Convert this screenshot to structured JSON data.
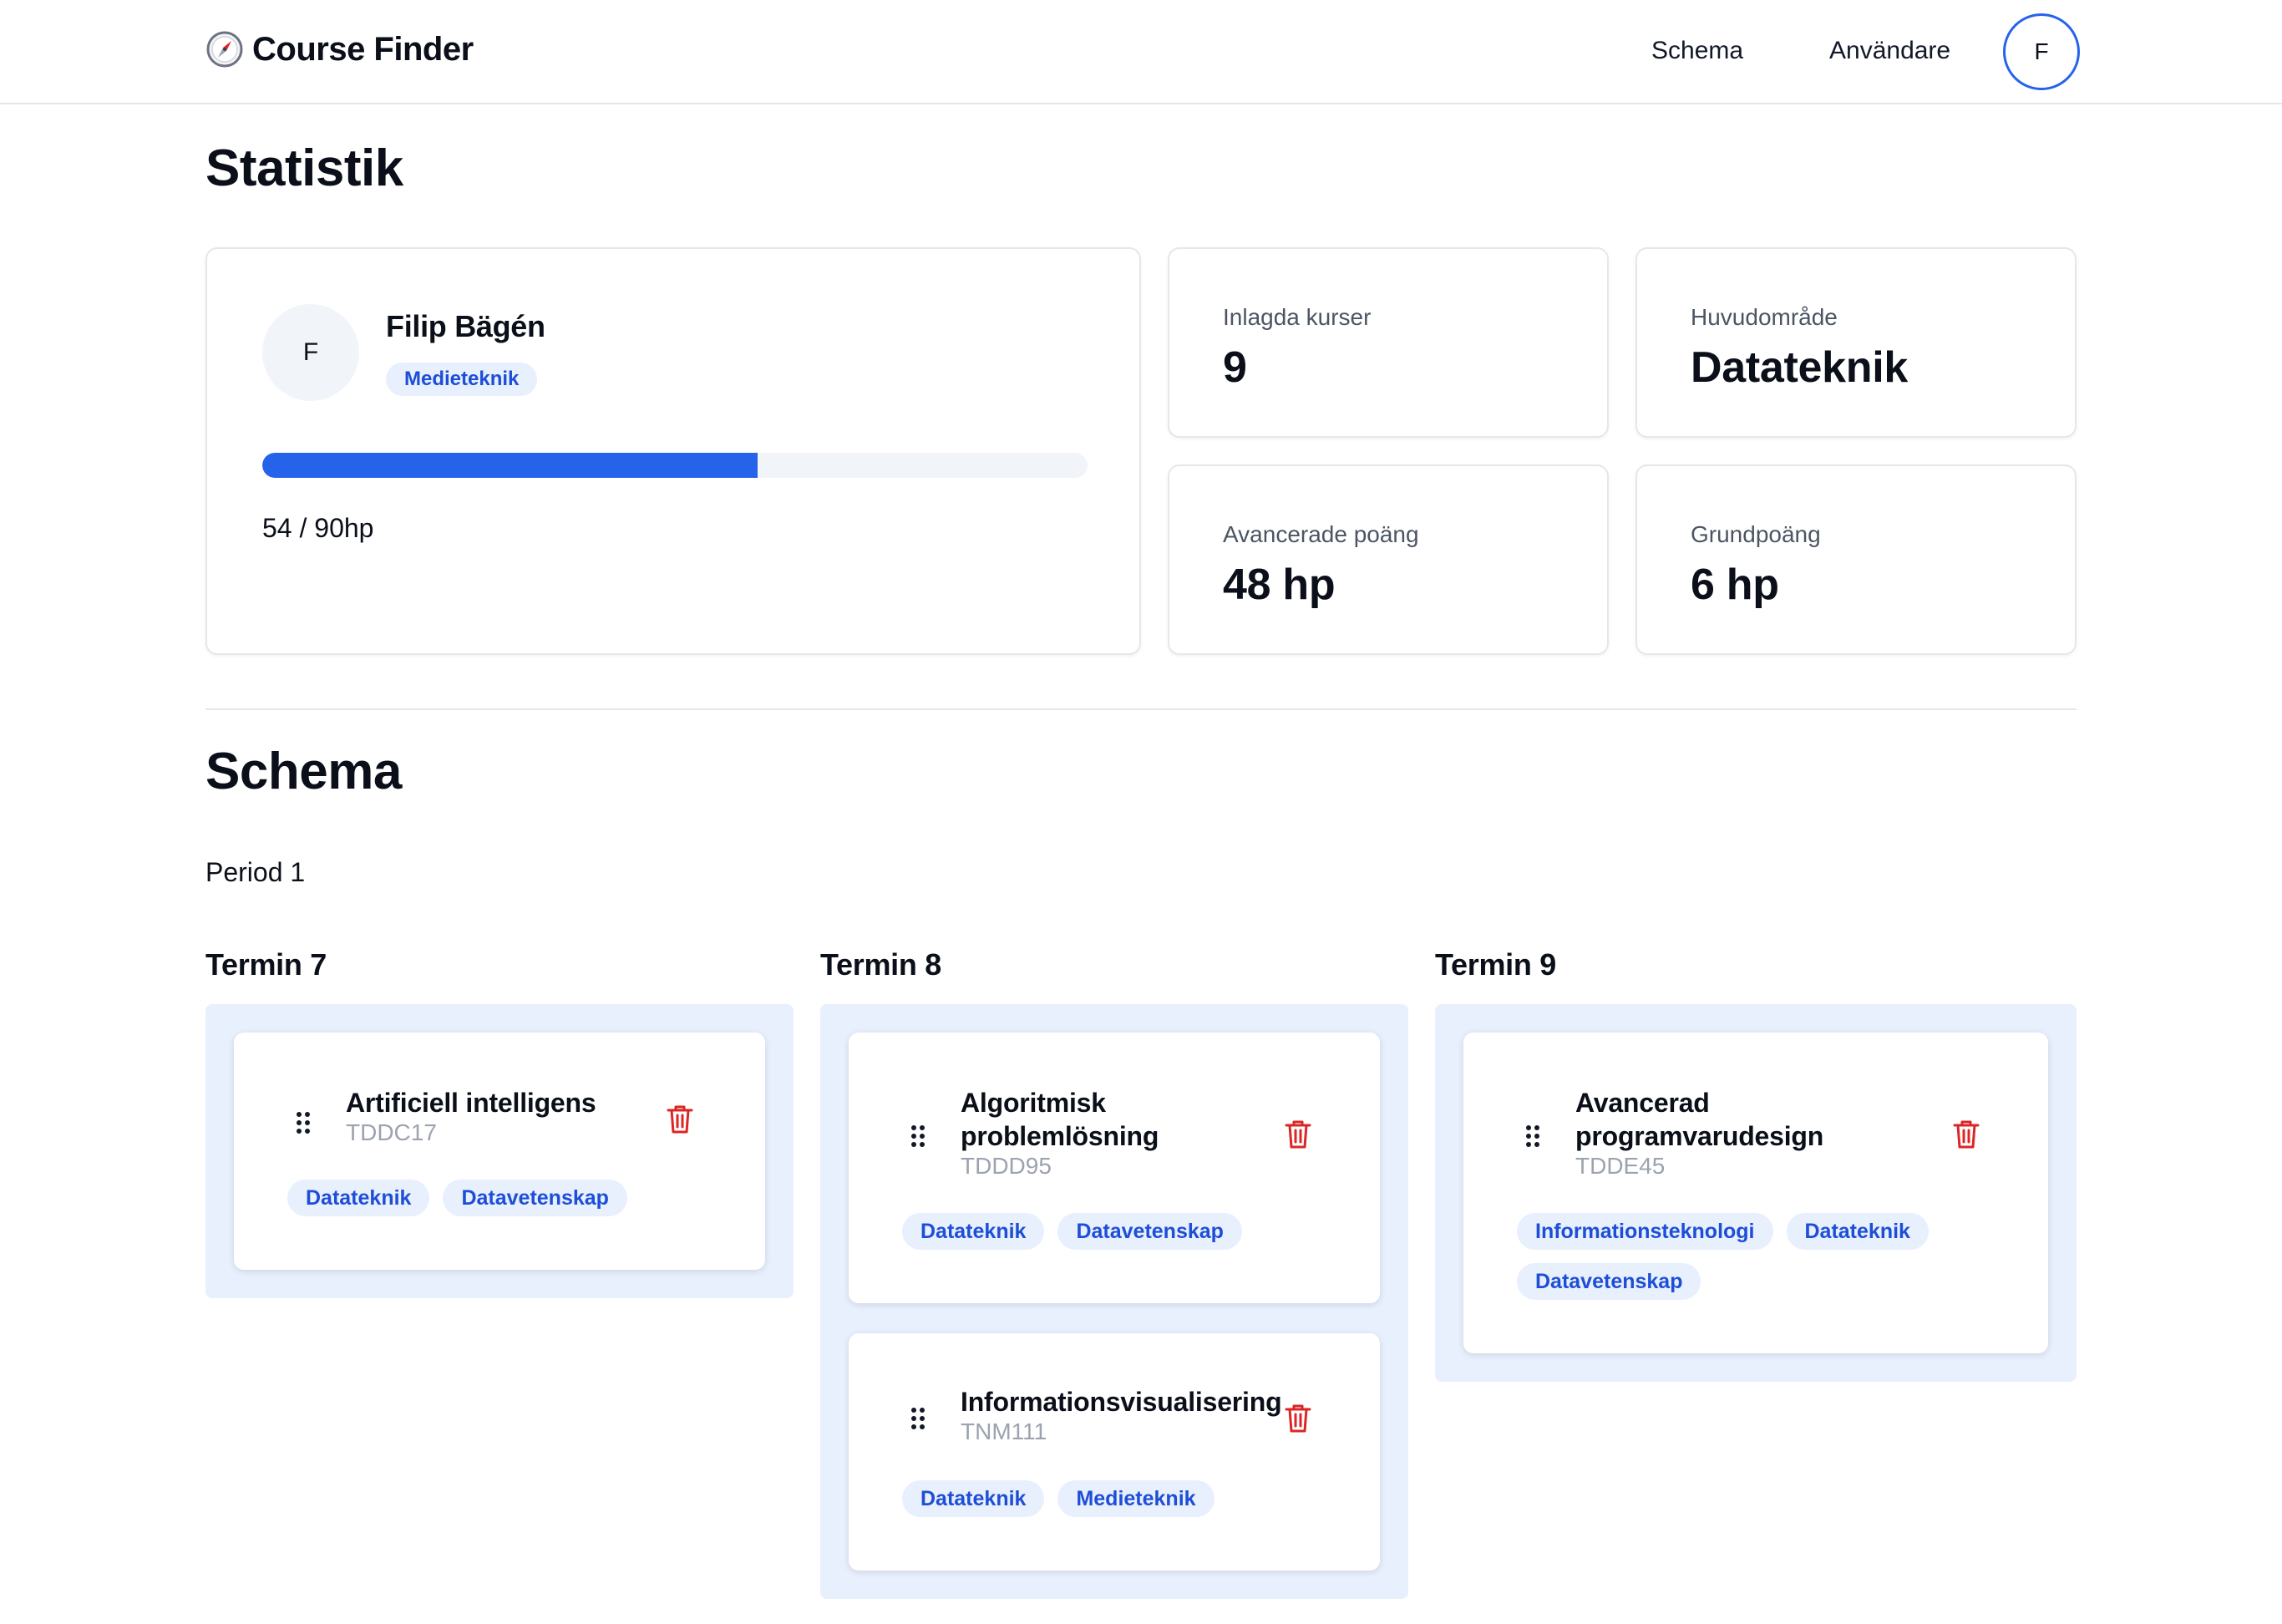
{
  "header": {
    "brand": "Course Finder",
    "nav": {
      "schema": "Schema",
      "users": "Användare"
    },
    "avatar_initial": "F"
  },
  "stats": {
    "title": "Statistik",
    "profile": {
      "initial": "F",
      "name": "Filip Bägén",
      "program": "Medieteknik",
      "progress_text": "54 / 90hp",
      "progress_fraction": 0.6
    },
    "cards": [
      {
        "label": "Inlagda kurser",
        "value": "9"
      },
      {
        "label": "Huvudområde",
        "value": "Datateknik"
      },
      {
        "label": "Avancerade poäng",
        "value": "48 hp"
      },
      {
        "label": "Grundpoäng",
        "value": "6 hp"
      }
    ]
  },
  "schedule": {
    "title": "Schema",
    "period": "Period 1",
    "terms": [
      {
        "title": "Termin 7",
        "courses": [
          {
            "name": "Artificiell intelligens",
            "code": "TDDC17",
            "tags": [
              "Datateknik",
              "Datavetenskap"
            ]
          }
        ]
      },
      {
        "title": "Termin 8",
        "courses": [
          {
            "name": "Algoritmisk problemlösning",
            "code": "TDDD95",
            "tags": [
              "Datateknik",
              "Datavetenskap"
            ]
          },
          {
            "name": "Informationsvisualisering",
            "code": "TNM111",
            "tags": [
              "Datateknik",
              "Medieteknik"
            ]
          }
        ]
      },
      {
        "title": "Termin 9",
        "courses": [
          {
            "name": "Avancerad programvarudesign",
            "code": "TDDE45",
            "tags": [
              "Informationsteknologi",
              "Datateknik",
              "Datavetenskap"
            ]
          }
        ]
      }
    ]
  },
  "colors": {
    "accent": "#2563eb",
    "danger": "#dc2626",
    "column_bg": "#e8effd"
  },
  "icons": {
    "logo": "compass-icon",
    "drag": "drag-handle-icon",
    "delete": "trash-icon"
  }
}
